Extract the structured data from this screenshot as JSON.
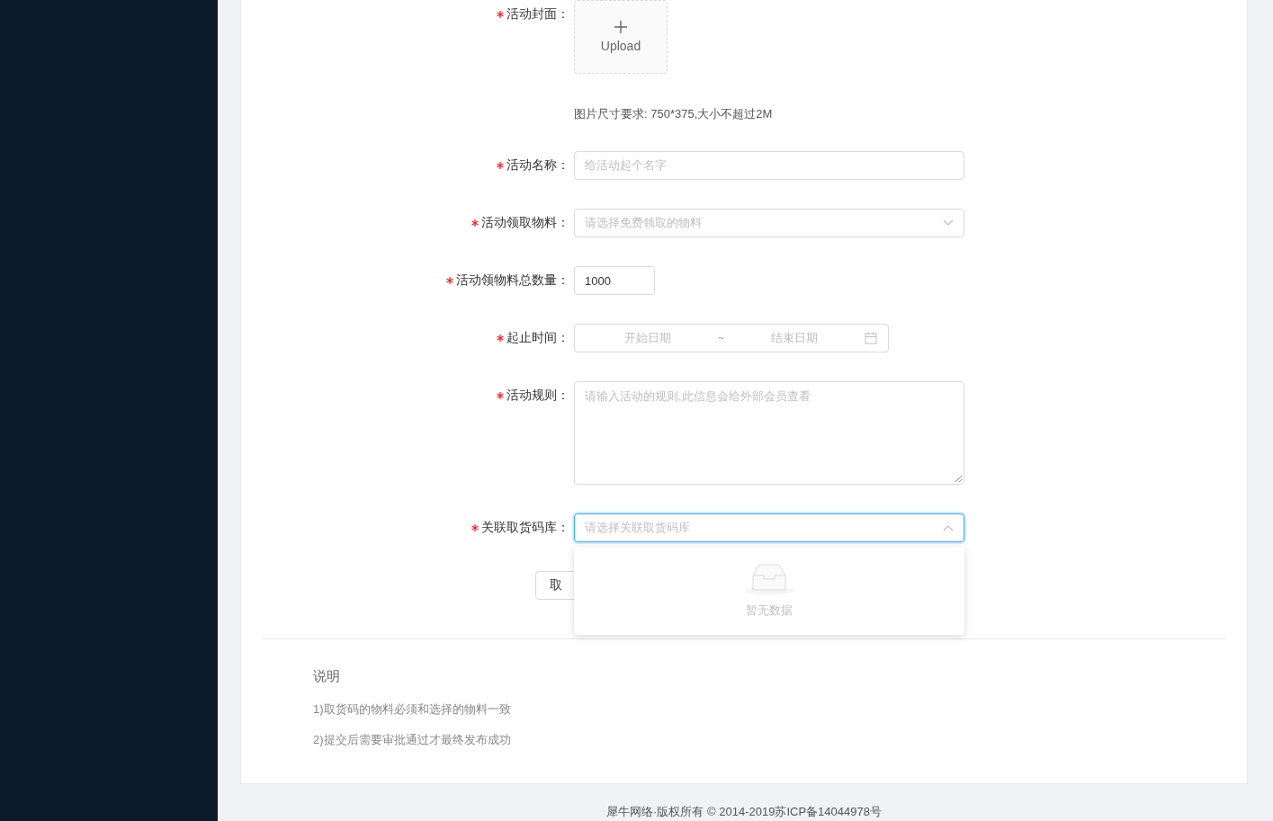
{
  "form": {
    "fields": [
      {
        "kind": "upload",
        "label": "活动封面：",
        "required": true,
        "button": "Upload",
        "hint": "图片尺寸要求: 750*375,大小不超过2M"
      },
      {
        "kind": "input",
        "label": "活动名称：",
        "required": true,
        "placeholder": "给活动起个名字"
      },
      {
        "kind": "select",
        "label": "活动领取物料：",
        "required": true,
        "placeholder": "请选择免费领取的物料",
        "expanded": false
      },
      {
        "kind": "number",
        "label": "活动领物料总数量：",
        "required": true,
        "value": "1000"
      },
      {
        "kind": "daterange",
        "label": "起止时间：",
        "required": true,
        "start_placeholder": "开始日期",
        "separator": "~",
        "end_placeholder": "结束日期"
      },
      {
        "kind": "textarea",
        "label": "活动规则：",
        "required": true,
        "placeholder": "请输入活动的规则,此信息会给外部会员查看"
      },
      {
        "kind": "select",
        "label": "关联取货码库：",
        "required": true,
        "placeholder": "请选择关联取货码库",
        "expanded": true,
        "empty_text": "暂无数据"
      }
    ],
    "cancel_button": "取"
  },
  "notes": {
    "title": "说明",
    "items": [
      "1)取货码的物料必须和选择的物料一致",
      "2)提交后需要审批通过才最终发布成功"
    ]
  },
  "footer": "犀牛网络·版权所有 © 2014-2019苏ICP备14044978号"
}
